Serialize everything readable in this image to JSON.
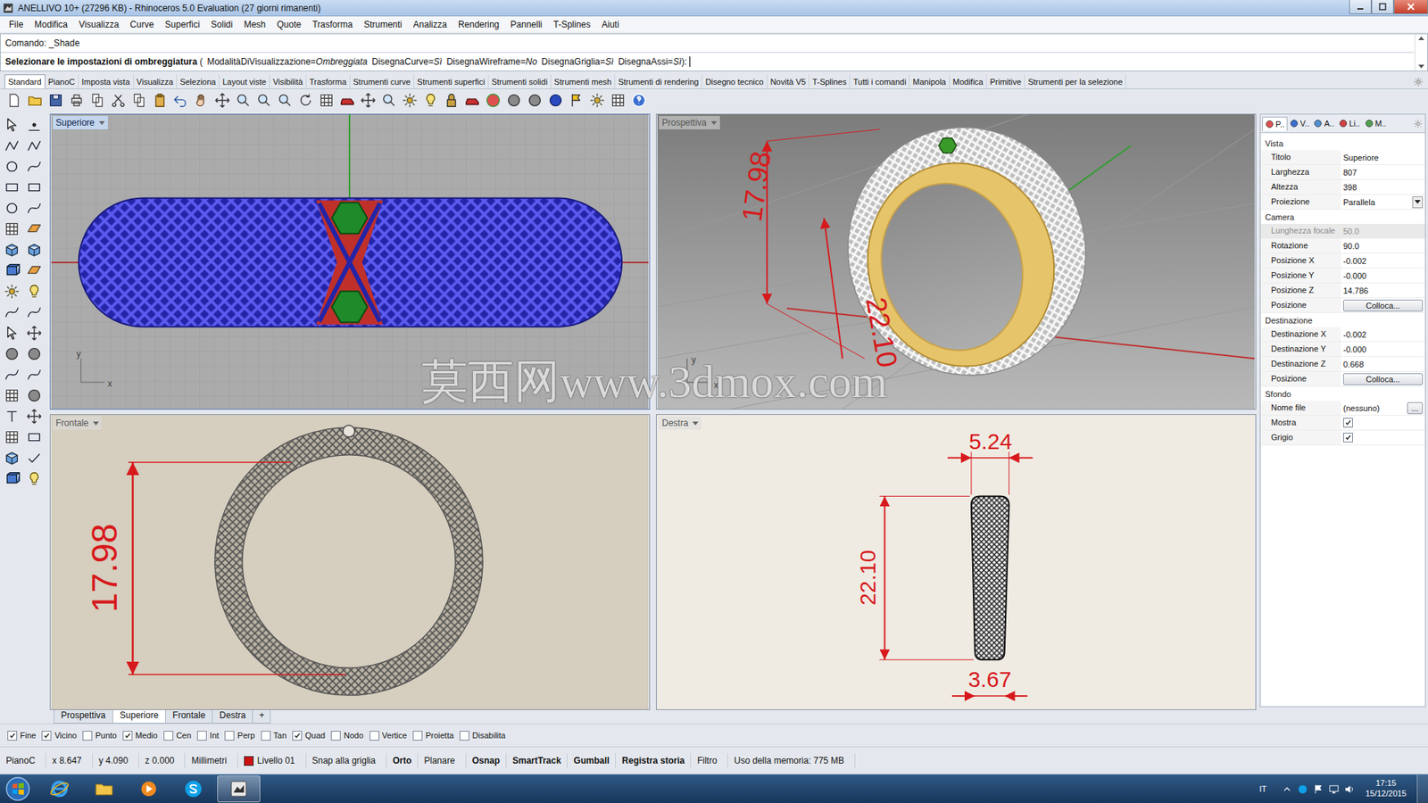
{
  "window": {
    "title": "ANELLIVO 10+ (27296 KB) - Rhinoceros 5.0 Evaluation (27 giorni rimanenti)"
  },
  "menu": [
    "File",
    "Modifica",
    "Visualizza",
    "Curve",
    "Superfici",
    "Solidi",
    "Mesh",
    "Quote",
    "Trasforma",
    "Strumenti",
    "Analizza",
    "Rendering",
    "Pannelli",
    "T-Splines",
    "Aiuti"
  ],
  "command": {
    "history": "Comando: _Shade",
    "prompt": "Selezionare le impostazioni di ombreggiatura",
    "open": "(",
    "close": "):",
    "options": [
      {
        "key": "ModalitàDiVisualizzazione=",
        "value": "Ombreggiata"
      },
      {
        "key": "DisegnaCurve=",
        "value": "Sì"
      },
      {
        "key": "DisegnaWireframe=",
        "value": "No"
      },
      {
        "key": "DisegnaGriglia=",
        "value": "Sì"
      },
      {
        "key": "DisegnaAssi=",
        "value": "Sì"
      }
    ]
  },
  "toolbar_tabs": [
    {
      "label": "Standard",
      "selected": true
    },
    {
      "label": "PianoC",
      "selected": false
    },
    {
      "label": "Imposta vista",
      "selected": false
    },
    {
      "label": "Visualizza",
      "selected": false
    },
    {
      "label": "Seleziona",
      "selected": false
    },
    {
      "label": "Layout viste",
      "selected": false
    },
    {
      "label": "Visibilità",
      "selected": false
    },
    {
      "label": "Trasforma",
      "selected": false
    },
    {
      "label": "Strumenti curve",
      "selected": false
    },
    {
      "label": "Strumenti superfici",
      "selected": false
    },
    {
      "label": "Strumenti solidi",
      "selected": false
    },
    {
      "label": "Strumenti mesh",
      "selected": false
    },
    {
      "label": "Strumenti di rendering",
      "selected": false
    },
    {
      "label": "Disegno tecnico",
      "selected": false
    },
    {
      "label": "Novità V5",
      "selected": false
    },
    {
      "label": "T-Splines",
      "selected": false
    },
    {
      "label": "Tutti i comandi",
      "selected": false
    },
    {
      "label": "Manipola",
      "selected": false
    },
    {
      "label": "Modifica",
      "selected": false
    },
    {
      "label": "Primitive",
      "selected": false
    },
    {
      "label": "Strumenti per la selezione",
      "selected": false
    }
  ],
  "viewports": [
    {
      "title": "Superiore",
      "view": "top",
      "selected": true,
      "dimensions": [],
      "axes": [
        "y",
        "x"
      ]
    },
    {
      "title": "Prospettiva",
      "view": "perspective",
      "selected": false,
      "dimensions": [
        "17.98",
        "22.10"
      ],
      "axes": [
        "y",
        "x"
      ]
    },
    {
      "title": "Frontale",
      "view": "front",
      "selected": false,
      "dimensions": [
        "17.98"
      ],
      "axes": []
    },
    {
      "title": "Destra",
      "view": "right",
      "selected": false,
      "dimensions": [
        "5.24",
        "22.10",
        "3.67"
      ],
      "axes": []
    }
  ],
  "watermark": "莫西网www.3dmox.com",
  "viewport_tabs": [
    {
      "label": "Prospettiva",
      "selected": false
    },
    {
      "label": "Superiore",
      "selected": true
    },
    {
      "label": "Frontale",
      "selected": false
    },
    {
      "label": "Destra",
      "selected": false
    }
  ],
  "add_tab": "+",
  "osnaps": [
    {
      "label": "Fine",
      "checked": true
    },
    {
      "label": "Vicino",
      "checked": true
    },
    {
      "label": "Punto",
      "checked": false
    },
    {
      "label": "Medio",
      "checked": true
    },
    {
      "label": "Cen",
      "checked": false
    },
    {
      "label": "Int",
      "checked": false
    },
    {
      "label": "Perp",
      "checked": false
    },
    {
      "label": "Tan",
      "checked": false
    },
    {
      "label": "Quad",
      "checked": true
    },
    {
      "label": "Nodo",
      "checked": false
    },
    {
      "label": "Vertice",
      "checked": false
    },
    {
      "label": "Proietta",
      "checked": false
    },
    {
      "label": "Disabilita",
      "checked": false
    }
  ],
  "status_bar": [
    {
      "text": "PianoC",
      "bold": false,
      "kind": "text"
    },
    {
      "text": "x 8.647",
      "bold": false,
      "kind": "text"
    },
    {
      "text": "y 4.090",
      "bold": false,
      "kind": "text"
    },
    {
      "text": "z 0.000",
      "bold": false,
      "kind": "text"
    },
    {
      "text": "Millimetri",
      "bold": false,
      "kind": "text"
    },
    {
      "text": "Livello 01",
      "bold": false,
      "kind": "layer",
      "color": "#cc1111"
    },
    {
      "text": "Snap alla griglia",
      "bold": false,
      "kind": "text"
    },
    {
      "text": "Orto",
      "bold": true,
      "kind": "text"
    },
    {
      "text": "Planare",
      "bold": false,
      "kind": "text"
    },
    {
      "text": "Osnap",
      "bold": true,
      "kind": "text"
    },
    {
      "text": "SmartTrack",
      "bold": true,
      "kind": "text"
    },
    {
      "text": "Gumball",
      "bold": true,
      "kind": "text"
    },
    {
      "text": "Registra storia",
      "bold": true,
      "kind": "text"
    },
    {
      "text": "Filtro",
      "bold": false,
      "kind": "text"
    },
    {
      "text": "Uso della memoria: 775 MB",
      "bold": false,
      "kind": "text"
    }
  ],
  "properties": {
    "tabs": [
      {
        "label": "P..",
        "selected": true
      },
      {
        "label": "V..",
        "selected": false
      },
      {
        "label": "A..",
        "selected": false
      },
      {
        "label": "Li..",
        "selected": false
      },
      {
        "label": "M..",
        "selected": false
      }
    ],
    "sections": [
      {
        "title": "Vista",
        "rows": [
          {
            "label": "Titolo",
            "value": "Superiore",
            "kind": "text",
            "disabled": false
          },
          {
            "label": "Larghezza",
            "value": "807",
            "kind": "text",
            "disabled": false
          },
          {
            "label": "Altezza",
            "value": "398",
            "kind": "text",
            "disabled": false
          },
          {
            "label": "Proiezione",
            "value": "Parallela",
            "kind": "dropdown",
            "disabled": false
          }
        ]
      },
      {
        "title": "Camera",
        "rows": [
          {
            "label": "Lunghezza focale",
            "value": "50.0",
            "kind": "text",
            "disabled": true
          },
          {
            "label": "Rotazione",
            "value": "90.0",
            "kind": "text",
            "disabled": false
          },
          {
            "label": "Posizione X",
            "value": "-0.002",
            "kind": "text",
            "disabled": false
          },
          {
            "label": "Posizione Y",
            "value": "-0.000",
            "kind": "text",
            "disabled": false
          },
          {
            "label": "Posizione Z",
            "value": "14.786",
            "kind": "text",
            "disabled": false
          },
          {
            "label": "Posizione",
            "value": "Colloca...",
            "kind": "button",
            "disabled": false
          }
        ]
      },
      {
        "title": "Destinazione",
        "rows": [
          {
            "label": "Destinazione X",
            "value": "-0.002",
            "kind": "text",
            "disabled": false
          },
          {
            "label": "Destinazione Y",
            "value": "-0.000",
            "kind": "text",
            "disabled": false
          },
          {
            "label": "Destinazione Z",
            "value": "0.668",
            "kind": "text",
            "disabled": false
          },
          {
            "label": "Posizione",
            "value": "Colloca...",
            "kind": "button",
            "disabled": false
          }
        ]
      },
      {
        "title": "Sfondo",
        "rows": [
          {
            "label": "Nome file",
            "value": "(nessuno)",
            "kind": "file",
            "button": "...",
            "disabled": false
          },
          {
            "label": "Mostra",
            "kind": "check",
            "checked": true,
            "disabled": false
          },
          {
            "label": "Grigio",
            "kind": "check",
            "checked": true,
            "disabled": false
          }
        ]
      }
    ]
  },
  "taskbar": {
    "apps": [
      {
        "kind": "browser",
        "selected": false
      },
      {
        "kind": "explorer",
        "selected": false
      },
      {
        "kind": "media",
        "selected": false
      },
      {
        "kind": "skype",
        "selected": false
      },
      {
        "kind": "rhino",
        "selected": true
      }
    ],
    "language": "IT",
    "time": "17:15",
    "date": "15/12/2015"
  }
}
